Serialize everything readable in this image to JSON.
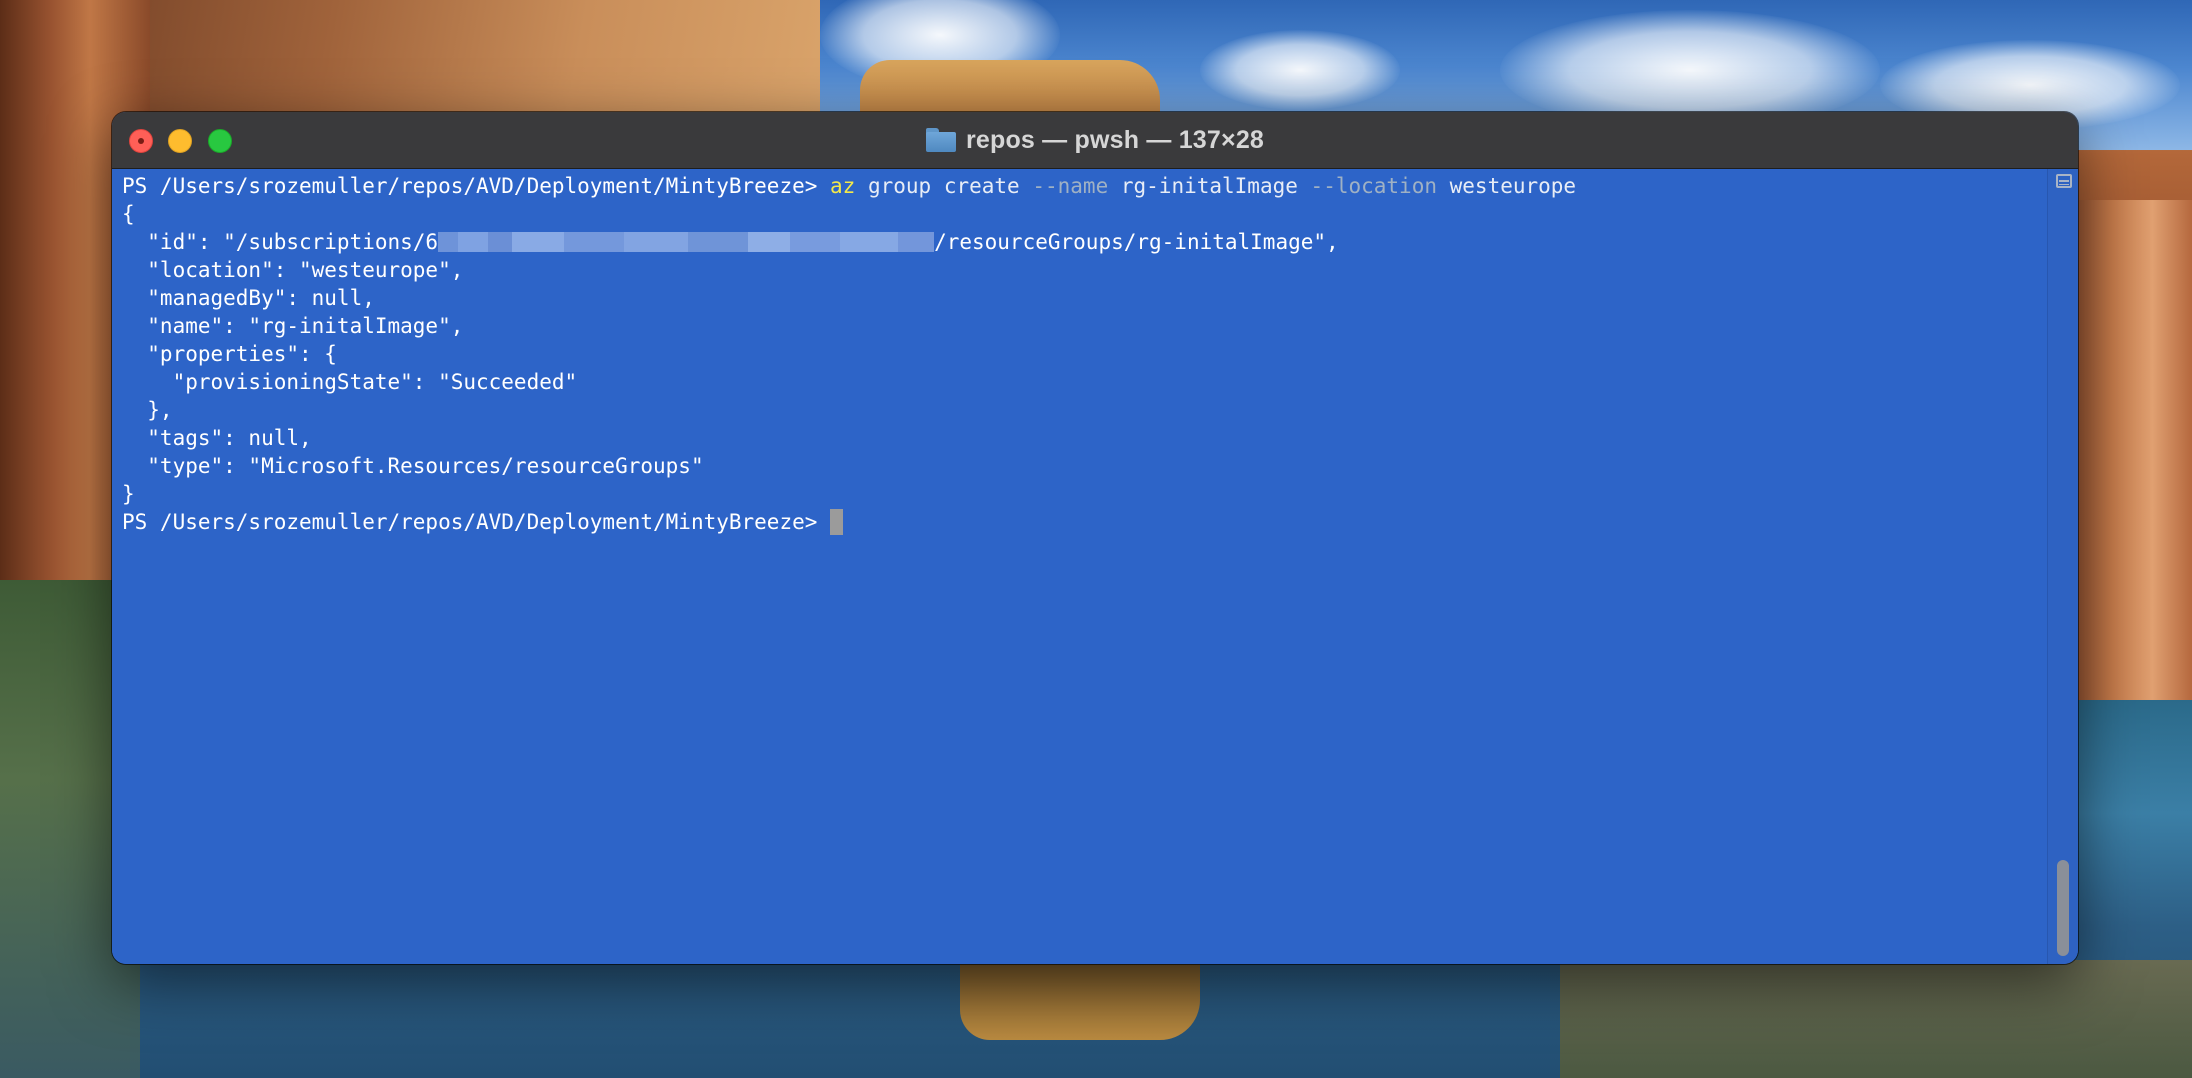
{
  "window": {
    "title": "repos — pwsh — 137×28"
  },
  "terminal": {
    "prompt": "PS /Users/srozemuller/repos/AVD/Deployment/MintyBreeze> ",
    "command": {
      "cmd": "az",
      "arg_group": "group",
      "arg_create": "create",
      "param_name": "--name",
      "value_name": "rg-initalImage",
      "param_location": "--location",
      "value_location": "westeurope"
    },
    "output": {
      "open_brace": "{",
      "id_prefix": "  \"id\": \"/subscriptions/6",
      "id_suffix": "/resourceGroups/rg-initalImage\",",
      "location": "  \"location\": \"westeurope\",",
      "managed_by": "  \"managedBy\": null,",
      "name": "  \"name\": \"rg-initalImage\",",
      "properties_open": "  \"properties\": {",
      "provisioning_state": "    \"provisioningState\": \"Succeeded\"",
      "properties_close": "  },",
      "tags": "  \"tags\": null,",
      "type": "  \"type\": \"Microsoft.Resources/resourceGroups\"",
      "close_brace": "}"
    },
    "second_prompt": "PS /Users/srozemuller/repos/AVD/Deployment/MintyBreeze> "
  },
  "colors": {
    "terminal_background": "#2d64c8",
    "command_highlight": "#f4e94a",
    "parameter": "#9fb1c4",
    "titlebar": "#3a3a3c"
  },
  "icons": {
    "close": "close-icon",
    "minimize": "minimize-icon",
    "maximize": "maximize-icon",
    "folder": "folder-icon",
    "split": "split-pane-icon"
  }
}
